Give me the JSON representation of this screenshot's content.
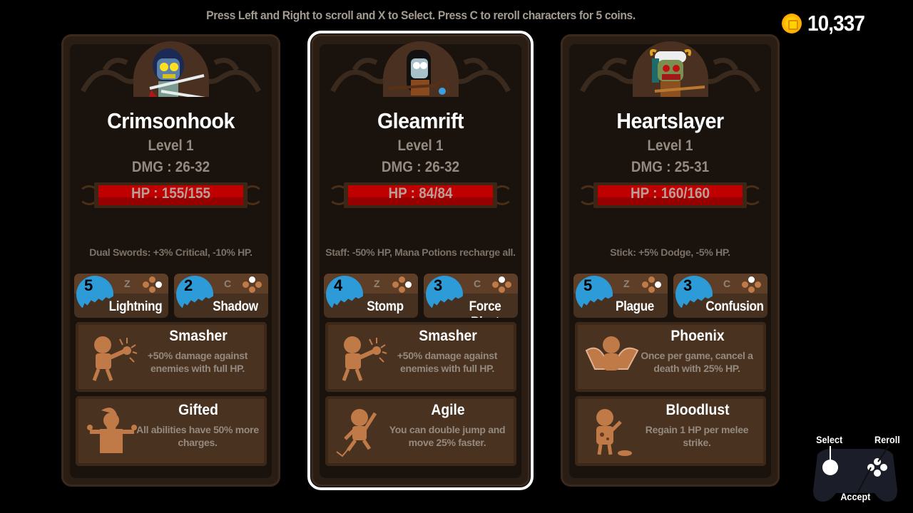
{
  "instructions": "Press Left and Right to scroll and X to Select. Press C to reroll characters for 5 coins.",
  "coins": {
    "icon": "coin-icon",
    "value": "10,337"
  },
  "characters": [
    {
      "name": "Crimsonhook",
      "level": "Level 1",
      "dmg": "DMG : 26-32",
      "hp": "HP : 155/155",
      "hp_fraction": 1.0,
      "weapon": "Dual Swords: +3% Critical, -10% HP.",
      "selected": false,
      "portrait": "zombie-swordsman-portrait",
      "abilities": [
        {
          "charges": "5",
          "key": "Z",
          "button": "right",
          "name": "Lightning"
        },
        {
          "charges": "2",
          "key": "C",
          "button": "top",
          "name": "Shadow"
        }
      ],
      "perks": [
        {
          "icon": "smasher-icon",
          "title": "Smasher",
          "desc": "+50% damage against enemies with full HP."
        },
        {
          "icon": "gifted-icon",
          "title": "Gifted",
          "desc": "All abilities have 50% more charges."
        }
      ]
    },
    {
      "name": "Gleamrift",
      "level": "Level 1",
      "dmg": "DMG : 26-32",
      "hp": "HP : 84/84",
      "hp_fraction": 1.0,
      "weapon": "Staff: -50% HP, Mana Potions recharge all.",
      "selected": true,
      "portrait": "mage-staff-portrait",
      "abilities": [
        {
          "charges": "4",
          "key": "Z",
          "button": "right",
          "name": "Stomp"
        },
        {
          "charges": "3",
          "key": "C",
          "button": "top",
          "name": "Force Blast"
        }
      ],
      "perks": [
        {
          "icon": "smasher-icon",
          "title": "Smasher",
          "desc": "+50% damage against enemies with full HP."
        },
        {
          "icon": "agile-icon",
          "title": "Agile",
          "desc": "You can double jump and move 25% faster."
        }
      ]
    },
    {
      "name": "Heartslayer",
      "level": "Level 1",
      "dmg": "DMG : 25-31",
      "hp": "HP : 160/160",
      "hp_fraction": 1.0,
      "weapon": "Stick: +5% Dodge, -5% HP.",
      "selected": false,
      "portrait": "horned-zombie-portrait",
      "abilities": [
        {
          "charges": "5",
          "key": "Z",
          "button": "right",
          "name": "Plague"
        },
        {
          "charges": "3",
          "key": "C",
          "button": "top",
          "name": "Confusion"
        }
      ],
      "perks": [
        {
          "icon": "phoenix-icon",
          "title": "Phoenix",
          "desc": "Once per game, cancel a death with 25% HP."
        },
        {
          "icon": "bloodlust-icon",
          "title": "Bloodlust",
          "desc": "Regain 1 HP per melee strike."
        }
      ]
    }
  ],
  "controller": {
    "select_label": "Select",
    "reroll_label": "Reroll",
    "accept_label": "Accept"
  },
  "colors": {
    "hp_bar": "#c00000",
    "charge": "#2e9bd9",
    "card_bg": "#2a1d14",
    "selected_outline": "#ffffff",
    "coin": "#ffc400"
  }
}
